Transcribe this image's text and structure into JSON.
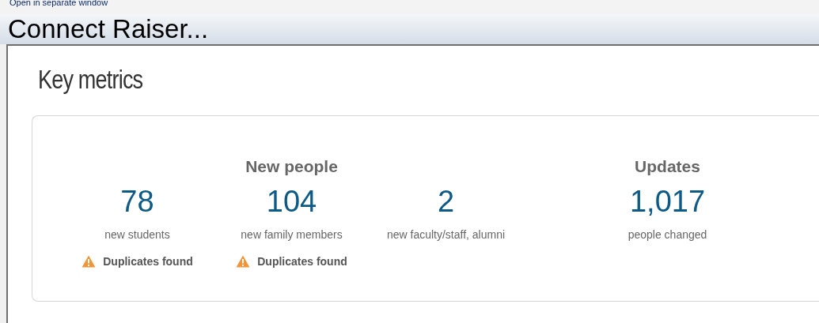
{
  "top_link": "Open in separate window",
  "window": {
    "title": "Connect Raiser..."
  },
  "section_title": "Key metrics",
  "groups": [
    {
      "heading": "New people",
      "metrics": [
        {
          "value": "78",
          "label": "new students",
          "warning": "Duplicates found"
        },
        {
          "value": "104",
          "label": "new family members",
          "warning": "Duplicates found"
        },
        {
          "value": "2",
          "label": "new faculty/staff, alumni"
        }
      ]
    },
    {
      "heading": "Updates",
      "metrics": [
        {
          "value": "1,017",
          "label": "people changed"
        }
      ]
    }
  ]
}
